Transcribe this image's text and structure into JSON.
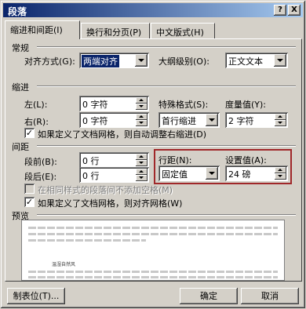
{
  "window": {
    "title": "段落",
    "help_button": "?",
    "close_button": "X"
  },
  "tabs": [
    {
      "label": "缩进和间距(I)",
      "active": true
    },
    {
      "label": "换行和分页(P)",
      "active": false
    },
    {
      "label": "中文版式(H)",
      "active": false
    }
  ],
  "general": {
    "section": "常规",
    "alignment_label": "对齐方式(G):",
    "alignment_value": "两端对齐",
    "outline_label": "大纲级别(O):",
    "outline_value": "正文文本"
  },
  "indent": {
    "section": "缩进",
    "left_label": "左(L):",
    "left_value": "0 字符",
    "right_label": "右(R):",
    "right_value": "0 字符",
    "special_label": "特殊格式(S):",
    "special_value": "首行缩进",
    "by_label": "度量值(Y):",
    "by_value": "2 字符",
    "auto_adjust_label": "如果定义了文档网格，则自动调整右缩进(D)",
    "auto_adjust_checked": true
  },
  "spacing": {
    "section": "间距",
    "before_label": "段前(B):",
    "before_value": "0 行",
    "after_label": "段后(E):",
    "after_value": "0 行",
    "line_spacing_label": "行距(N):",
    "line_spacing_value": "固定值",
    "at_label": "设置值(A):",
    "at_value": "24 磅",
    "no_space_label": "在相同样式的段落间不添加空格(M)",
    "no_space_checked": false,
    "snap_grid_label": "如果定义了文档网格，则对齐网格(W)",
    "snap_grid_checked": true
  },
  "preview": {
    "section": "预览",
    "sample_text": "温湿自然风"
  },
  "buttons": {
    "tabs": "制表位(T)...",
    "ok": "确定",
    "cancel": "取消"
  },
  "colors": {
    "title_bar": "#0a246a",
    "highlight": "#a0282a"
  }
}
